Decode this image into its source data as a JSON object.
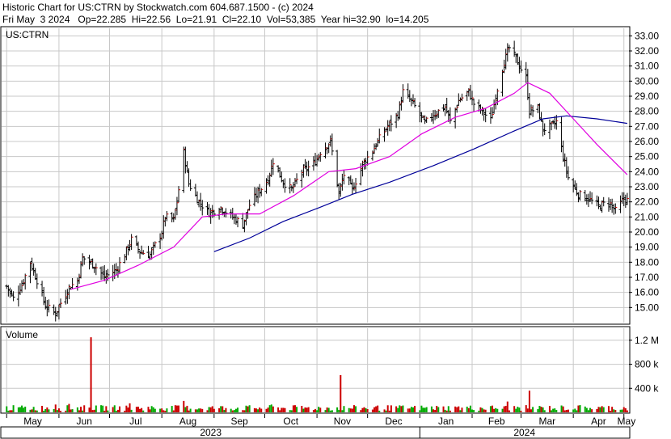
{
  "header": {
    "line1": "Historic Chart for US:CTRN by Stockwatch.com 604.687.1500 - (c) 2024",
    "line2": "Fri May  3 2024   Op=22.285  Hi=22.56  Lo=21.91  Cl=22.10  Vol=53,385  Year hi=32.90  lo=14.205"
  },
  "price_panel": {
    "label": "US:CTRN"
  },
  "volume_panel": {
    "label": "Volume"
  },
  "months": [
    "May",
    "Jun",
    "Jul",
    "Aug",
    "Sep",
    "Oct",
    "Nov",
    "Dec",
    "Jan",
    "Feb",
    "Mar",
    "Apr",
    "May"
  ],
  "years": [
    "2023",
    "2024"
  ],
  "colors": {
    "bar": "#000000",
    "up": "#cc0000",
    "ma_short": "#e000e0",
    "ma_long": "#000099",
    "vol_up": "#00aa00",
    "vol_down": "#cc0000",
    "grid": "#c8c8c8"
  },
  "chart_data": [
    {
      "type": "ohlc",
      "title": "US:CTRN",
      "ylim": [
        14,
        33.5
      ],
      "yticks": [
        15,
        16,
        17,
        18,
        19,
        20,
        21,
        22,
        23,
        24,
        25,
        26,
        27,
        28,
        29,
        30,
        31,
        32,
        33
      ],
      "ytick_labels": [
        "15.00",
        "16.00",
        "17.00",
        "18.00",
        "19.00",
        "20.00",
        "21.00",
        "22.00",
        "23.00",
        "24.00",
        "25.00",
        "26.00",
        "27.00",
        "28.00",
        "29.00",
        "30.00",
        "31.00",
        "32.00",
        "33.00"
      ],
      "grid": true,
      "close_anchors": [
        [
          "2023-05-01",
          16.4
        ],
        [
          "2023-05-05",
          15.6
        ],
        [
          "2023-05-10",
          16.5
        ],
        [
          "2023-05-15",
          18.0
        ],
        [
          "2023-05-19",
          16.8
        ],
        [
          "2023-05-24",
          15.1
        ],
        [
          "2023-05-30",
          14.6
        ],
        [
          "2023-06-02",
          15.3
        ],
        [
          "2023-06-07",
          16.3
        ],
        [
          "2023-06-12",
          16.8
        ],
        [
          "2023-06-15",
          18.3
        ],
        [
          "2023-06-22",
          17.8
        ],
        [
          "2023-06-28",
          17.0
        ],
        [
          "2023-07-05",
          17.5
        ],
        [
          "2023-07-10",
          18.5
        ],
        [
          "2023-07-14",
          19.5
        ],
        [
          "2023-07-19",
          18.7
        ],
        [
          "2023-07-25",
          18.5
        ],
        [
          "2023-08-01",
          20.0
        ],
        [
          "2023-08-03",
          21.0
        ],
        [
          "2023-08-08",
          20.8
        ],
        [
          "2023-08-10",
          22.0
        ],
        [
          "2023-08-14",
          25.3
        ],
        [
          "2023-08-17",
          23.2
        ],
        [
          "2023-08-23",
          22.0
        ],
        [
          "2023-08-29",
          21.3
        ],
        [
          "2023-09-05",
          21.6
        ],
        [
          "2023-09-12",
          21.0
        ],
        [
          "2023-09-18",
          20.5
        ],
        [
          "2023-09-22",
          21.8
        ],
        [
          "2023-09-27",
          22.6
        ],
        [
          "2023-10-03",
          23.5
        ],
        [
          "2023-10-06",
          24.7
        ],
        [
          "2023-10-12",
          23.3
        ],
        [
          "2023-10-17",
          22.8
        ],
        [
          "2023-10-23",
          24.0
        ],
        [
          "2023-10-30",
          24.5
        ],
        [
          "2023-11-03",
          25.3
        ],
        [
          "2023-11-09",
          26.0
        ],
        [
          "2023-11-14",
          22.5
        ],
        [
          "2023-11-17",
          23.8
        ],
        [
          "2023-11-22",
          22.8
        ],
        [
          "2023-11-28",
          24.5
        ],
        [
          "2023-12-04",
          25.4
        ],
        [
          "2023-12-08",
          26.2
        ],
        [
          "2023-12-13",
          27.0
        ],
        [
          "2023-12-19",
          27.8
        ],
        [
          "2023-12-22",
          29.3
        ],
        [
          "2023-12-28",
          28.5
        ],
        [
          "2024-01-04",
          27.2
        ],
        [
          "2024-01-09",
          27.8
        ],
        [
          "2024-01-16",
          28.3
        ],
        [
          "2024-01-19",
          27.3
        ],
        [
          "2024-01-24",
          28.7
        ],
        [
          "2024-01-30",
          29.3
        ],
        [
          "2024-02-02",
          28.5
        ],
        [
          "2024-02-07",
          28.0
        ],
        [
          "2024-02-12",
          27.4
        ],
        [
          "2024-02-16",
          29.5
        ],
        [
          "2024-02-20",
          31.3
        ],
        [
          "2024-02-23",
          32.2
        ],
        [
          "2024-02-27",
          31.5
        ],
        [
          "2024-03-01",
          30.8
        ],
        [
          "2024-03-04",
          30.2
        ],
        [
          "2024-03-06",
          28.0
        ],
        [
          "2024-03-11",
          28.2
        ],
        [
          "2024-03-14",
          26.8
        ],
        [
          "2024-03-19",
          27.0
        ],
        [
          "2024-03-22",
          27.3
        ],
        [
          "2024-03-26",
          25.0
        ],
        [
          "2024-03-29",
          23.6
        ],
        [
          "2024-04-04",
          22.5
        ],
        [
          "2024-04-10",
          22.2
        ],
        [
          "2024-04-16",
          21.7
        ],
        [
          "2024-04-22",
          22.0
        ],
        [
          "2024-04-26",
          21.4
        ],
        [
          "2024-05-01",
          22.2
        ],
        [
          "2024-05-03",
          22.1
        ]
      ],
      "ma_short": [
        [
          "2023-06-08",
          16.2
        ],
        [
          "2023-06-28",
          16.8
        ],
        [
          "2023-07-18",
          17.8
        ],
        [
          "2023-08-08",
          19.0
        ],
        [
          "2023-08-25",
          21.0
        ],
        [
          "2023-09-08",
          21.2
        ],
        [
          "2023-09-28",
          21.2
        ],
        [
          "2023-10-18",
          22.4
        ],
        [
          "2023-11-08",
          24.0
        ],
        [
          "2023-11-24",
          24.2
        ],
        [
          "2023-12-14",
          25.0
        ],
        [
          "2024-01-02",
          26.5
        ],
        [
          "2024-01-22",
          27.6
        ],
        [
          "2024-02-09",
          28.2
        ],
        [
          "2024-02-26",
          29.2
        ],
        [
          "2024-03-05",
          29.9
        ],
        [
          "2024-03-18",
          29.2
        ],
        [
          "2024-04-01",
          27.5
        ],
        [
          "2024-04-15",
          25.8
        ],
        [
          "2024-05-03",
          23.8
        ]
      ],
      "ma_long": [
        [
          "2023-09-01",
          18.7
        ],
        [
          "2023-09-22",
          19.6
        ],
        [
          "2023-10-12",
          20.7
        ],
        [
          "2023-11-02",
          21.6
        ],
        [
          "2023-11-22",
          22.5
        ],
        [
          "2023-12-14",
          23.3
        ],
        [
          "2024-01-09",
          24.4
        ],
        [
          "2024-02-02",
          25.5
        ],
        [
          "2024-02-26",
          26.7
        ],
        [
          "2024-03-14",
          27.5
        ],
        [
          "2024-03-28",
          27.7
        ],
        [
          "2024-04-15",
          27.5
        ],
        [
          "2024-05-03",
          27.2
        ]
      ]
    },
    {
      "type": "bar",
      "title": "Volume",
      "ylim": [
        0,
        1400000
      ],
      "yticks": [
        400000,
        800000,
        1200000
      ],
      "ytick_labels": [
        "400 k",
        "800 k",
        "1.2 M"
      ],
      "grid": true,
      "base_volume": 80000,
      "spikes": [
        [
          "2023-06-20",
          1250000
        ],
        [
          "2023-11-15",
          620000
        ],
        [
          "2024-03-06",
          360000
        ],
        [
          "2024-02-22",
          180000
        ],
        [
          "2023-08-14",
          190000
        ],
        [
          "2023-05-30",
          130000
        ],
        [
          "2023-06-07",
          140000
        ],
        [
          "2023-07-13",
          150000
        ],
        [
          "2023-10-05",
          130000
        ],
        [
          "2024-04-05",
          120000
        ]
      ]
    }
  ]
}
